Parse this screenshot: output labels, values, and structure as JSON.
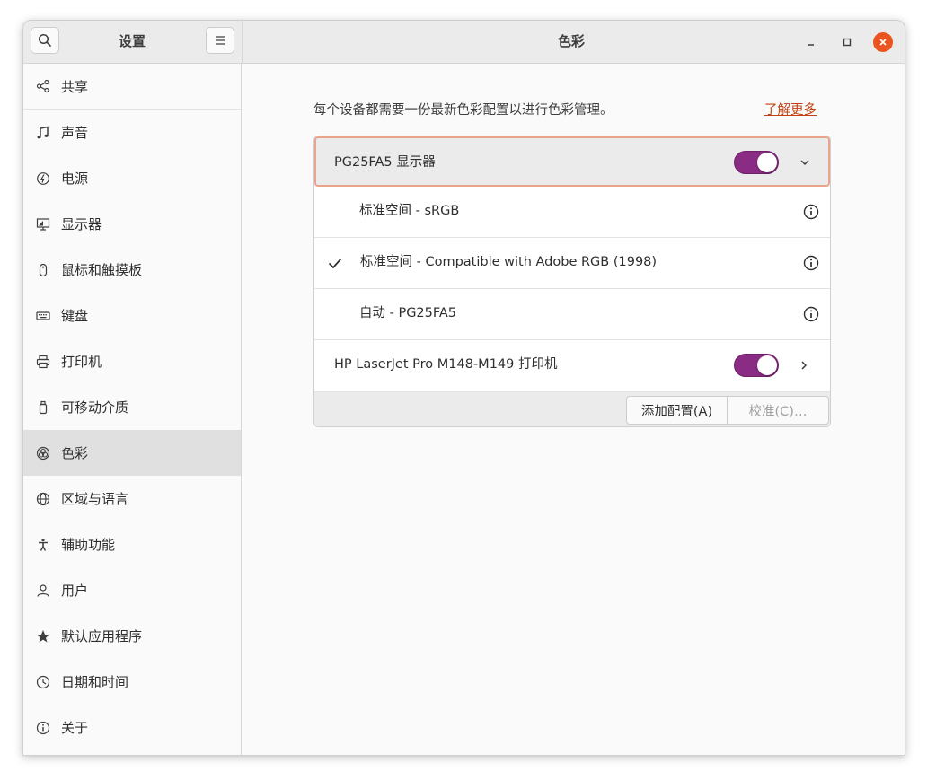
{
  "header": {
    "sidebar_title": "设置",
    "title": "色彩",
    "search_icon": "search-icon",
    "menu_icon": "hamburger-menu-icon"
  },
  "sidebar": {
    "items": [
      {
        "label": "共享",
        "icon": "share-icon"
      },
      {
        "label": "声音",
        "icon": "music-note-icon"
      },
      {
        "label": "电源",
        "icon": "power-icon"
      },
      {
        "label": "显示器",
        "icon": "display-icon"
      },
      {
        "label": "鼠标和触摸板",
        "icon": "mouse-icon"
      },
      {
        "label": "键盘",
        "icon": "keyboard-icon"
      },
      {
        "label": "打印机",
        "icon": "printer-icon"
      },
      {
        "label": "可移动介质",
        "icon": "usb-drive-icon"
      },
      {
        "label": "色彩",
        "icon": "color-icon"
      },
      {
        "label": "区域与语言",
        "icon": "globe-icon"
      },
      {
        "label": "辅助功能",
        "icon": "accessibility-icon"
      },
      {
        "label": "用户",
        "icon": "user-icon"
      },
      {
        "label": "默认应用程序",
        "icon": "star-icon"
      },
      {
        "label": "日期和时间",
        "icon": "clock-icon"
      },
      {
        "label": "关于",
        "icon": "info-icon"
      }
    ],
    "active": "色彩"
  },
  "main": {
    "description": "每个设备都需要一份最新色彩配置以进行色彩管理。",
    "learn_more": "了解更多",
    "devices": [
      {
        "label": "PG25FA5 显示器",
        "enabled": true,
        "expanded": true,
        "profiles": [
          {
            "label": "标准空间 - sRGB",
            "selected": false
          },
          {
            "label": "标准空间 - Compatible with Adobe RGB (1998)",
            "selected": true
          },
          {
            "label": "自动 - PG25FA5",
            "selected": false
          }
        ]
      },
      {
        "label": "HP LaserJet Pro M148-M149 打印机",
        "enabled": true,
        "expanded": false
      }
    ],
    "add_profile_label": "添加配置(A)",
    "calibrate_label": "校准(C)…"
  },
  "colors": {
    "accent_toggle": "#8b2c84",
    "link": "#c34113",
    "close_button": "#e95420",
    "selection_border": "#e9a48a"
  }
}
